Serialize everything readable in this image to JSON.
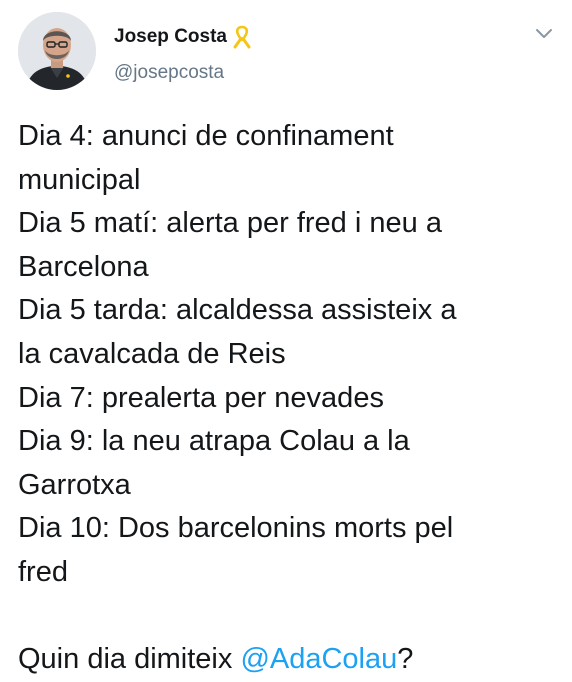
{
  "author": {
    "name": "Josep Costa",
    "handle": "@josepcosta",
    "avatar_icon": "profile-photo",
    "badge_icon": "yellow-ribbon-icon"
  },
  "header": {
    "menu_icon": "chevron-down-icon"
  },
  "tweet": {
    "lines": [
      "Dia 4: anunci de confinament",
      "municipal",
      "Dia 5 matí: alerta per fred i neu a",
      "Barcelona",
      "Dia 5 tarda: alcaldessa assisteix a",
      "la cavalcada de Reis",
      "Dia 7: prealerta per nevades",
      "Dia 9: la neu atrapa Colau a la",
      "Garrotxa",
      "Dia 10: Dos barcelonins morts pel",
      "fred"
    ],
    "question_prefix": "Quin dia dimiteix ",
    "mention": "@AdaColau",
    "question_suffix": "?"
  },
  "colors": {
    "text": "#14171a",
    "secondary": "#657786",
    "link": "#1da1f2",
    "ribbon": "#f5c518"
  }
}
